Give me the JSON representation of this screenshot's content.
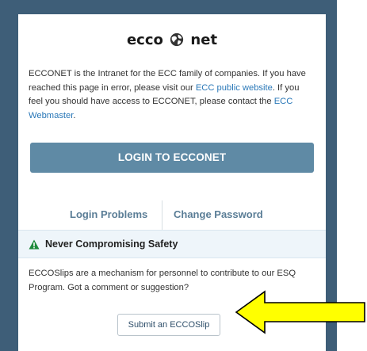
{
  "logo": {
    "left": "ecco",
    "right": "net",
    "icon": "globe-icon"
  },
  "intro": {
    "part1": "ECCONET is the Intranet for the ECC family of companies. If you have reached this page in error, please visit our ",
    "link_public": "ECC public website",
    "part2": ". If you feel you should have access to ECCONET, please contact the ",
    "link_webmaster": "ECC Webmaster",
    "part3": "."
  },
  "login_button": "LOGIN TO ECCONET",
  "links": {
    "problems": "Login Problems",
    "password": "Change Password"
  },
  "safety": {
    "icon": "warning-triangle-icon",
    "title": "Never Compromising Safety",
    "description": "ECCOSlips are a mechanism for personnel to contribute to our ESQ Program. Got a comment or suggestion?",
    "button": "Submit an ECCOSlip"
  },
  "colors": {
    "page_background": "#3e5e78",
    "login_button": "#5f8aa5",
    "link": "#2a78b8",
    "secondary_link": "#5a7d96",
    "warning_icon": "#1e8a3c",
    "arrow_fill": "#ffff00"
  }
}
